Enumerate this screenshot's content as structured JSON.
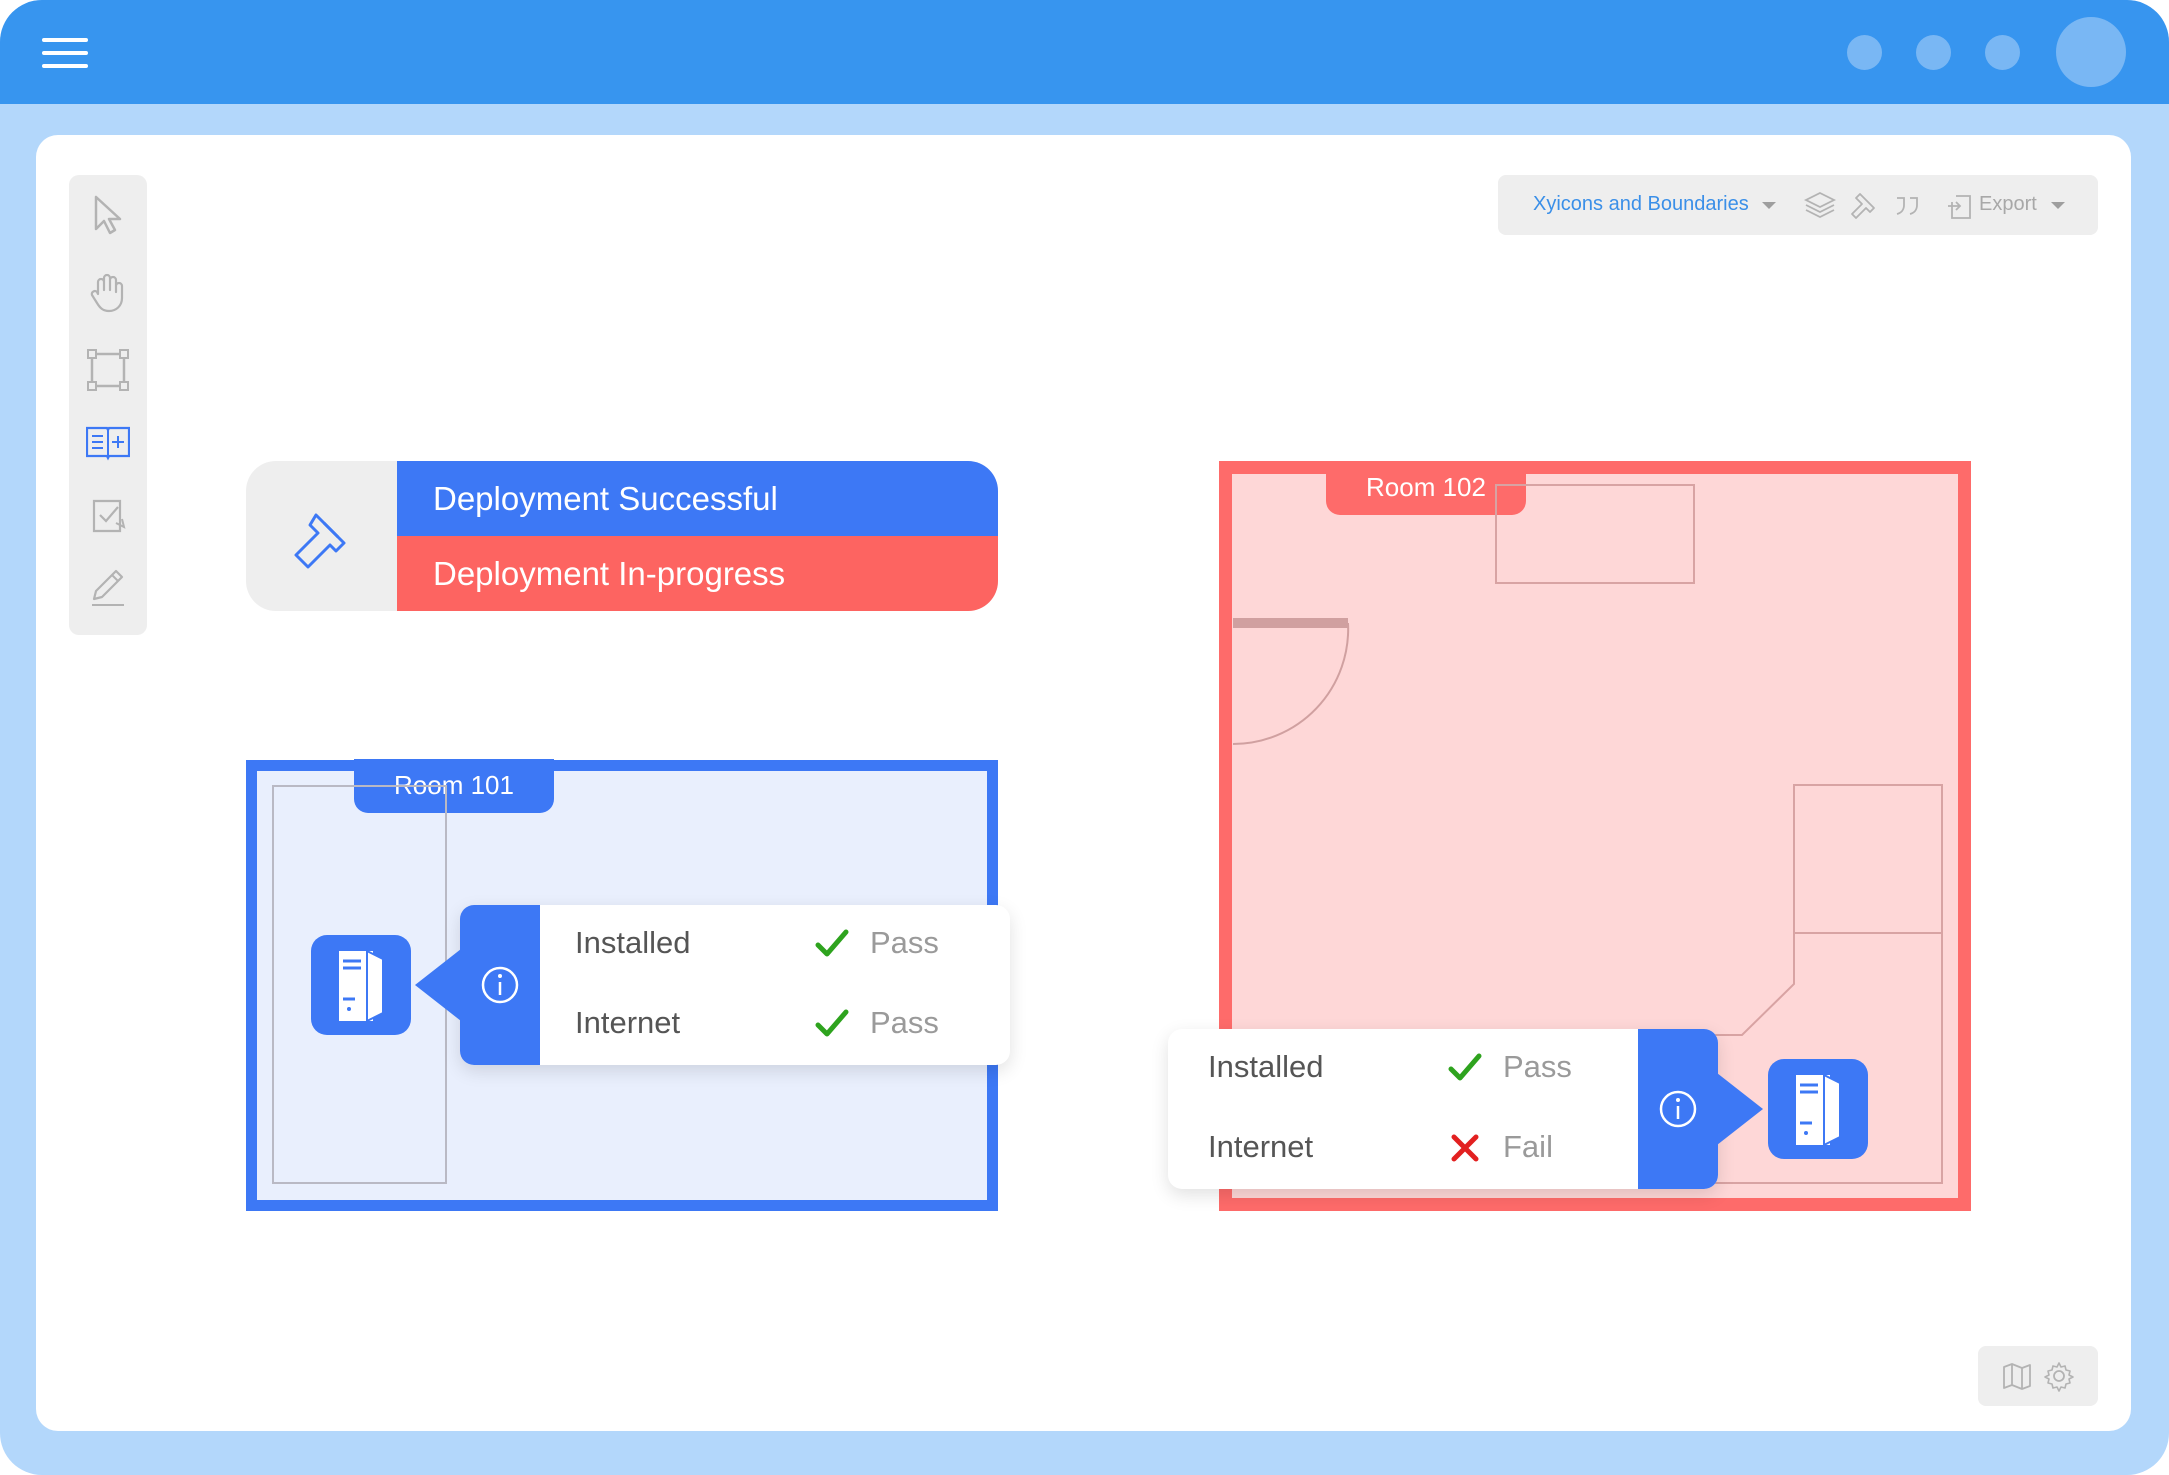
{
  "header": {
    "menu_icon": "hamburger-menu-icon",
    "dots": [
      "dot",
      "dot",
      "dot"
    ],
    "avatar_icon": "user-avatar"
  },
  "left_toolbar": {
    "tools": [
      "pointer-icon",
      "hand-icon",
      "select-rect-icon",
      "add-boundary-icon",
      "import-icon",
      "edit-pencil-icon"
    ],
    "active_tool": "add-boundary-icon"
  },
  "top_toolbar": {
    "layer_select": "Xyicons and Boundaries",
    "icons": [
      "layers-icon",
      "paint-icon",
      "quote-icon"
    ],
    "export_label": "Export"
  },
  "bottom_toolbar": {
    "icons": [
      "map-icon",
      "gear-icon"
    ]
  },
  "legend": {
    "icon": "paint-brush-icon",
    "success_label": "Deployment Successful",
    "progress_label": "Deployment In-progress",
    "success_color": "#3d78f5",
    "progress_color": "#fd6461"
  },
  "room101": {
    "name": "Room 101",
    "status": {
      "rows": [
        {
          "label": "Installed",
          "result": "Pass",
          "mark": "check-icon"
        },
        {
          "label": "Internet",
          "result": "Pass",
          "mark": "check-icon"
        }
      ]
    }
  },
  "room102": {
    "name": "Room 102",
    "status": {
      "rows": [
        {
          "label": "Installed",
          "result": "Pass",
          "mark": "check-icon"
        },
        {
          "label": "Internet",
          "result": "Fail",
          "mark": "cross-icon"
        }
      ]
    }
  }
}
